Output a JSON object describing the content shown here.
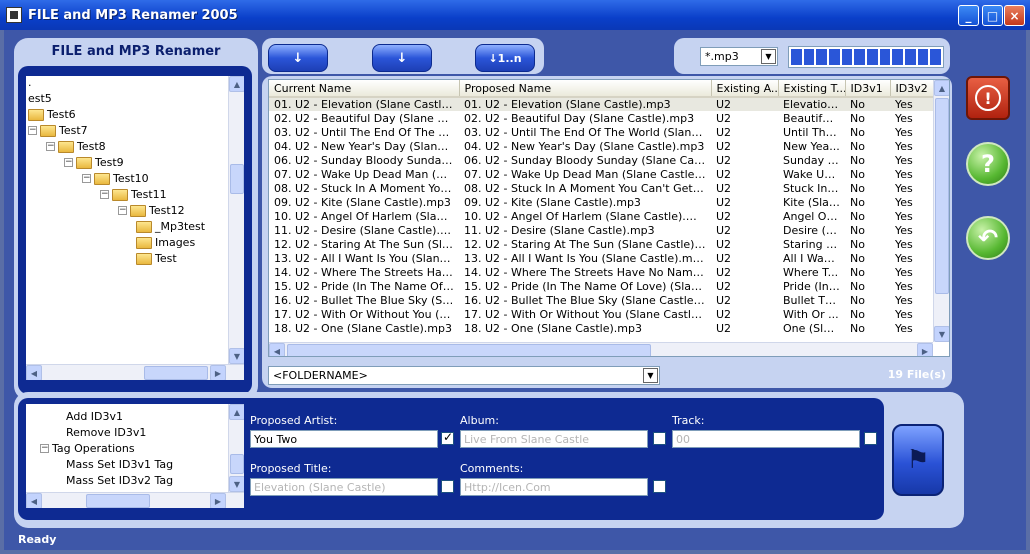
{
  "window": {
    "title": "FILE and MP3 Renamer 2005",
    "minimize": "_",
    "maximize": "□",
    "close": "×"
  },
  "app_header": "FILE and MP3 Renamer",
  "folder_tree": [
    {
      "label": ".",
      "level": 0,
      "folder": false,
      "expander": ""
    },
    {
      "label": "est5",
      "level": 0,
      "folder": false,
      "expander": ""
    },
    {
      "label": "Test6",
      "level": 0,
      "folder": true,
      "expander": ""
    },
    {
      "label": "Test7",
      "level": 0,
      "folder": true,
      "expander": "−"
    },
    {
      "label": "Test8",
      "level": 1,
      "folder": true,
      "expander": "−"
    },
    {
      "label": "Test9",
      "level": 2,
      "folder": true,
      "expander": "−"
    },
    {
      "label": "Test10",
      "level": 3,
      "folder": true,
      "expander": "−"
    },
    {
      "label": "Test11",
      "level": 4,
      "folder": true,
      "expander": "−"
    },
    {
      "label": "Test12",
      "level": 5,
      "folder": true,
      "expander": "−"
    },
    {
      "label": "_Mp3test",
      "level": 6,
      "folder": true,
      "expander": ""
    },
    {
      "label": "Images",
      "level": 6,
      "folder": true,
      "expander": ""
    },
    {
      "label": "Test",
      "level": 6,
      "folder": true,
      "expander": ""
    }
  ],
  "toolbar": {
    "btn1": "↓",
    "btn2": "↓",
    "btn3": "↓1..n"
  },
  "filter": {
    "value": "*.mp3"
  },
  "progress": 0,
  "columns": [
    "Current Name",
    "Proposed Name",
    "Existing A...",
    "Existing T...",
    "ID3v1",
    "ID3v2"
  ],
  "rows": [
    [
      "01. U2 - Elevation (Slane Castle).mp3",
      "01. U2 - Elevation (Slane Castle).mp3",
      "U2",
      "Elevation...",
      "No",
      "Yes"
    ],
    [
      "02. U2 - Beautiful Day (Slane Castle)....",
      "02. U2 - Beautiful Day (Slane Castle).mp3",
      "U2",
      "Beautiful ...",
      "No",
      "Yes"
    ],
    [
      "03. U2 - Until The End Of The World...",
      "03. U2 - Until The End Of The World (Slane Cast...",
      "U2",
      "Until The ...",
      "No",
      "Yes"
    ],
    [
      "04. U2 - New Year's Day (Slane Castl...",
      "04. U2 - New Year's Day (Slane Castle).mp3",
      "U2",
      "New Yea...",
      "No",
      "Yes"
    ],
    [
      "06. U2 - Sunday Bloody Sunday (Sla...",
      "06. U2 - Sunday Bloody Sunday (Slane Castle).m...",
      "U2",
      "Sunday B...",
      "No",
      "Yes"
    ],
    [
      "07. U2 - Wake Up Dead Man (Slane...",
      "07. U2 - Wake Up Dead Man (Slane Castle).mp3",
      "U2",
      "Wake Up...",
      "No",
      "Yes"
    ],
    [
      "08. U2 - Stuck In A Moment You Ca...",
      "08. U2 - Stuck In A Moment You Can't Get Out ...",
      "U2",
      "Stuck In ...",
      "No",
      "Yes"
    ],
    [
      "09. U2 - Kite (Slane Castle).mp3",
      "09. U2 - Kite (Slane Castle).mp3",
      "U2",
      "Kite (Slan...",
      "No",
      "Yes"
    ],
    [
      "10. U2 - Angel Of Harlem (Slane Cast...",
      "10. U2 - Angel Of Harlem (Slane Castle).mp3",
      "U2",
      "Angel Of ...",
      "No",
      "Yes"
    ],
    [
      "11. U2 - Desire (Slane Castle).mp3",
      "11. U2 - Desire (Slane Castle).mp3",
      "U2",
      "Desire (Sl...",
      "No",
      "Yes"
    ],
    [
      "12. U2 - Staring At The Sun (Slane C...",
      "12. U2 - Staring At The Sun (Slane Castle).mp3",
      "U2",
      "Staring At...",
      "No",
      "Yes"
    ],
    [
      "13. U2 - All I Want Is You (Slane Cas...",
      "13. U2 - All I Want Is You (Slane Castle).mp3",
      "U2",
      "All I Want ...",
      "No",
      "Yes"
    ],
    [
      "14. U2 - Where The Streets Have N...",
      "14. U2 - Where The Streets Have No Name (Sla...",
      "U2",
      "Where T...",
      "No",
      "Yes"
    ],
    [
      "15. U2 - Pride (In The Name Of Love...",
      "15. U2 - Pride (In The Name Of Love) (Slane Ca...",
      "U2",
      "Pride (In ...",
      "No",
      "Yes"
    ],
    [
      "16. U2 - Bullet The Blue Sky (Slane ...",
      "16. U2 - Bullet The Blue Sky (Slane Castle).mp3",
      "U2",
      "Bullet Th...",
      "No",
      "Yes"
    ],
    [
      "17. U2 - With Or Without You (Slane ...",
      "17. U2 - With Or Without You (Slane Castle).mp3",
      "U2",
      "With Or ...",
      "No",
      "Yes"
    ],
    [
      "18. U2 - One (Slane Castle).mp3",
      "18. U2 - One (Slane Castle).mp3",
      "U2",
      "One (Sla...",
      "No",
      "Yes"
    ]
  ],
  "pattern": {
    "value": "<FOLDERNAME>"
  },
  "file_count": "19 File(s)",
  "ops_tree": [
    {
      "label": "Add ID3v1",
      "level": 2,
      "expander": ""
    },
    {
      "label": "Remove ID3v1",
      "level": 2,
      "expander": ""
    },
    {
      "label": "Tag Operations",
      "level": 1,
      "expander": "−"
    },
    {
      "label": "Mass Set ID3v1 Tag",
      "level": 2,
      "expander": ""
    },
    {
      "label": "Mass Set ID3v2 Tag",
      "level": 2,
      "expander": ""
    }
  ],
  "form": {
    "artist_label": "Proposed Artist:",
    "artist_value": "You Two",
    "album_label": "Album:",
    "album_value": "Live From Slane Castle",
    "track_label": "Track:",
    "track_value": "00",
    "title_label": "Proposed Title:",
    "title_value": "Elevation (Slane Castle)",
    "comments_label": "Comments:",
    "comments_value": "Http://Icen.Com"
  },
  "status": "Ready",
  "colors": {
    "accent": "#0e2a92",
    "panel": "#c6d3f1",
    "stop": "#c8301a",
    "help": "#6cc24a"
  }
}
